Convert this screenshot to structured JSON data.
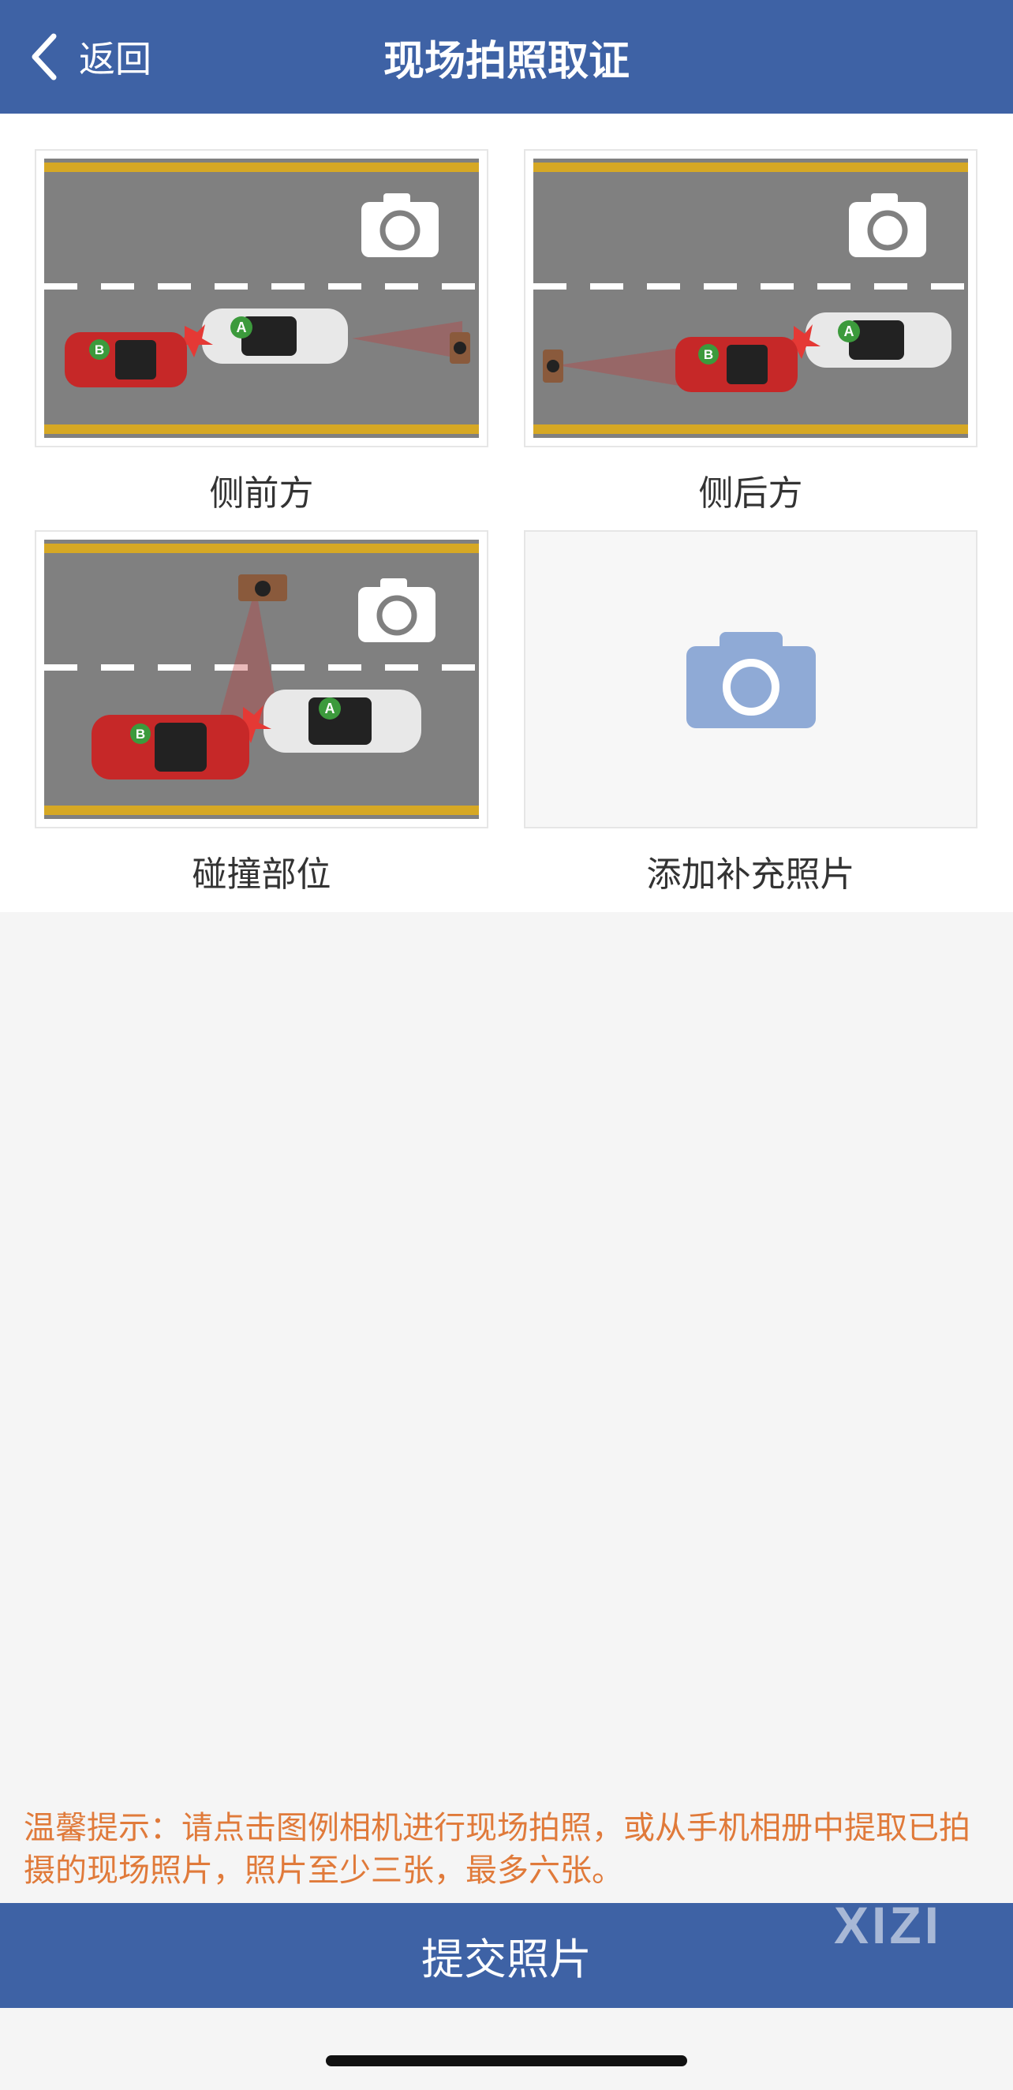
{
  "header": {
    "back_label": "返回",
    "title": "现场拍照取证"
  },
  "photos": [
    {
      "label": "侧前方"
    },
    {
      "label": "侧后方"
    },
    {
      "label": "碰撞部位"
    },
    {
      "label": "添加补充照片"
    }
  ],
  "car_labels": {
    "a": "A",
    "b": "B"
  },
  "tip": "温馨提示：请点击图例相机进行现场拍照，或从手机相册中提取已拍摄的现场照片，照片至少三张，最多六张。",
  "submit_label": "提交照片",
  "watermark": "XIZI",
  "colors": {
    "brand": "#3e62a5",
    "tip": "#e07a3a",
    "road": "#808080",
    "lane_yellow": "#d6a824",
    "car_red": "#c62828",
    "add_icon": "#8faad6"
  }
}
